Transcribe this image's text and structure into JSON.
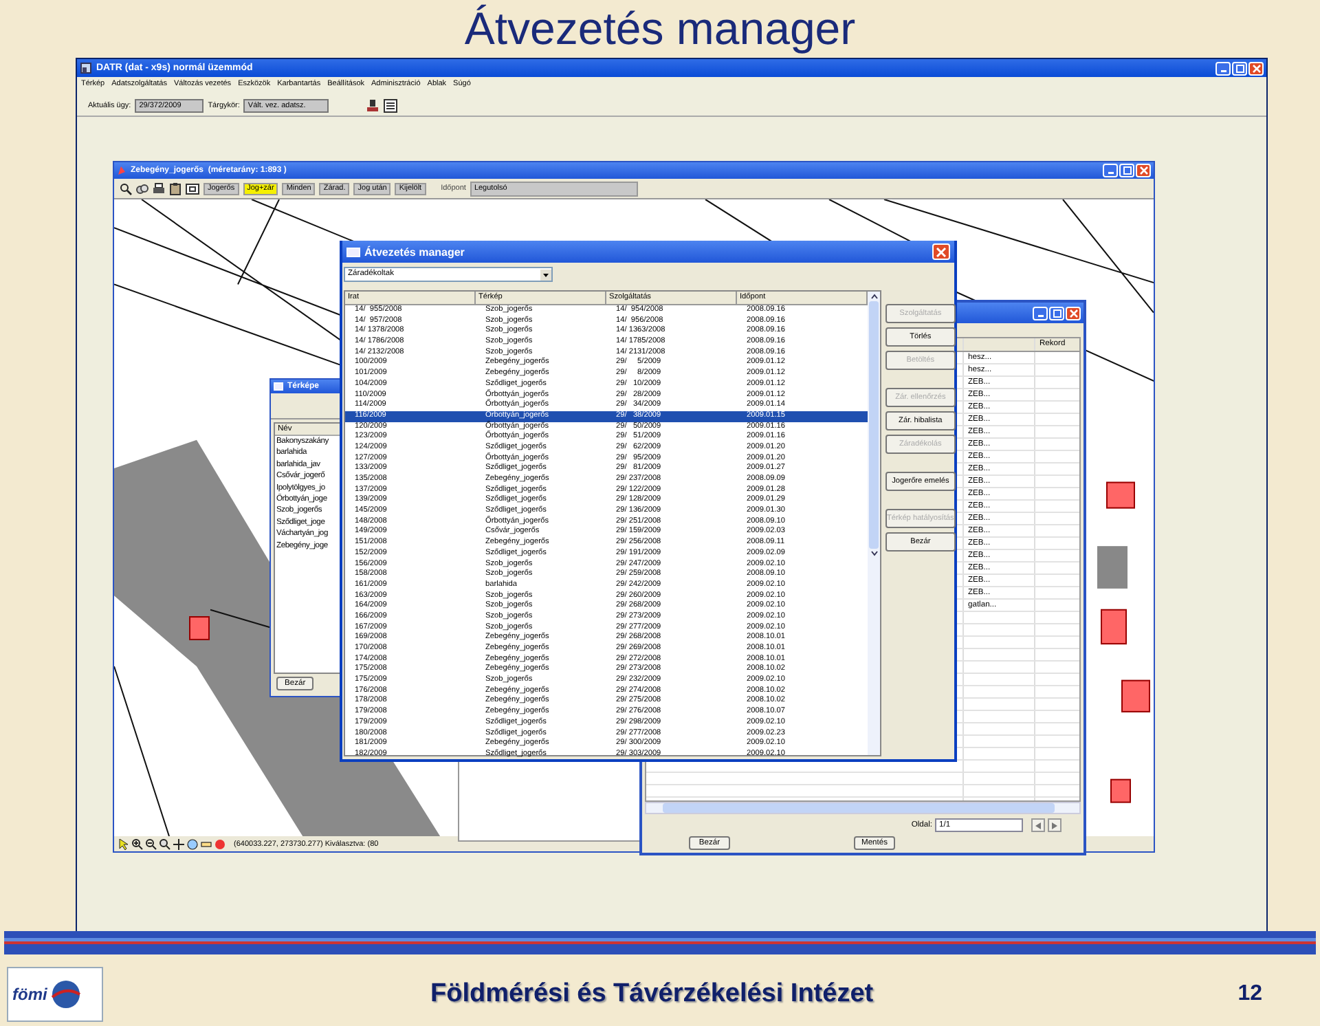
{
  "slide": {
    "title": "Átvezetés manager",
    "logo_text": "fömi",
    "footer": "Földmérési és Távérzékelési Intézet",
    "page_number": "12"
  },
  "app_window": {
    "title": "DATR (dat - x9s) normál üzemmód",
    "menu": [
      "Térkép",
      "Adatszolgáltatás",
      "Változás vezetés",
      "Eszközök",
      "Karbantartás",
      "Beállítások",
      "Adminisztráció",
      "Ablak",
      "Súgó"
    ],
    "case_label": "Aktuális ügy:",
    "case_value": "29/372/2009",
    "topic_label": "Tárgykör:",
    "topic_value": "Vált. vez. adatsz."
  },
  "map_window": {
    "title": "Zebegény_jogerős  (méretarány: 1:893 )",
    "filters": [
      {
        "label": "Jogerős",
        "selected": false
      },
      {
        "label": "Jog+zár",
        "selected": true
      },
      {
        "label": "Minden",
        "selected": false
      },
      {
        "label": "Zárad.",
        "selected": false
      },
      {
        "label": "Jog után",
        "selected": false
      },
      {
        "label": "Kijelölt",
        "selected": false
      }
    ],
    "time_label": "Időpont",
    "time_value": "Legutolsó",
    "status": "(640033.227, 273730.277) Kiválasztva: (80"
  },
  "maps_window": {
    "title": "Térképe",
    "column": "Név",
    "items": [
      "Bakonyszakány",
      "barlahida",
      "barlahida_jav",
      "Csővár_jogerő",
      "Ipolytölgyes_jo",
      "Őrbottyán_joge",
      "Szob_jogerős",
      "Sződliget_joge",
      "Váchartyán_jog",
      "Zebegény_joge"
    ],
    "close_button": "Bezár"
  },
  "records_window": {
    "column": "Rekord",
    "rows": [
      "hesz...",
      "hesz...",
      "ZEB...",
      "ZEB...",
      "ZEB...",
      "ZEB...",
      "ZEB...",
      "ZEB...",
      "ZEB...",
      "ZEB...",
      "ZEB...",
      "ZEB...",
      "ZEB...",
      "ZEB...",
      "ZEB...",
      "ZEB...",
      "ZEB...",
      "ZEB...",
      "ZEB...",
      "ZEB...",
      "gatlan..."
    ],
    "page_label": "Oldal:",
    "page_value": "1/1",
    "buttons": [
      "Bezár",
      "Mentés"
    ]
  },
  "dialog": {
    "title": "Átvezetés manager",
    "filter": "Záradékoltak",
    "columns": [
      "Irat",
      "Térkép",
      "Szolgáltatás",
      "Időpont"
    ],
    "rows": [
      {
        "irat": "14/  955/2008",
        "terkep": "Szob_jogerős",
        "szolg": "14/  954/2008",
        "ido": "2008.09.16",
        "selected": false
      },
      {
        "irat": "14/  957/2008",
        "terkep": "Szob_jogerős",
        "szolg": "14/  956/2008",
        "ido": "2008.09.16",
        "selected": false
      },
      {
        "irat": "14/ 1378/2008",
        "terkep": "Szob_jogerős",
        "szolg": "14/ 1363/2008",
        "ido": "2008.09.16",
        "selected": false
      },
      {
        "irat": "14/ 1786/2008",
        "terkep": "Szob_jogerős",
        "szolg": "14/ 1785/2008",
        "ido": "2008.09.16",
        "selected": false
      },
      {
        "irat": "14/ 2132/2008",
        "terkep": "Szob_jogerős",
        "szolg": "14/ 2131/2008",
        "ido": "2008.09.16",
        "selected": false
      },
      {
        "irat": "100/2009",
        "terkep": "Zebegény_jogerős",
        "szolg": "29/     5/2009",
        "ido": "2009.01.12",
        "selected": false
      },
      {
        "irat": "101/2009",
        "terkep": "Zebegény_jogerős",
        "szolg": "29/     8/2009",
        "ido": "2009.01.12",
        "selected": false
      },
      {
        "irat": "104/2009",
        "terkep": "Sződliget_jogerős",
        "szolg": "29/   10/2009",
        "ido": "2009.01.12",
        "selected": false
      },
      {
        "irat": "110/2009",
        "terkep": "Őrbottyán_jogerős",
        "szolg": "29/   28/2009",
        "ido": "2009.01.12",
        "selected": false
      },
      {
        "irat": "114/2009",
        "terkep": "Őrbottyán_jogerős",
        "szolg": "29/   34/2009",
        "ido": "2009.01.14",
        "selected": false
      },
      {
        "irat": "116/2009",
        "terkep": "Őrbottyán_jogerős",
        "szolg": "29/   38/2009",
        "ido": "2009.01.15",
        "selected": true
      },
      {
        "irat": "120/2009",
        "terkep": "Őrbottyán_jogerős",
        "szolg": "29/   50/2009",
        "ido": "2009.01.16",
        "selected": false
      },
      {
        "irat": "123/2009",
        "terkep": "Őrbottyán_jogerős",
        "szolg": "29/   51/2009",
        "ido": "2009.01.16",
        "selected": false
      },
      {
        "irat": "124/2009",
        "terkep": "Sződliget_jogerős",
        "szolg": "29/   62/2009",
        "ido": "2009.01.20",
        "selected": false
      },
      {
        "irat": "127/2009",
        "terkep": "Őrbottyán_jogerős",
        "szolg": "29/   95/2009",
        "ido": "2009.01.20",
        "selected": false
      },
      {
        "irat": "133/2009",
        "terkep": "Sződliget_jogerős",
        "szolg": "29/   81/2009",
        "ido": "2009.01.27",
        "selected": false
      },
      {
        "irat": "135/2008",
        "terkep": "Zebegény_jogerős",
        "szolg": "29/ 237/2008",
        "ido": "2008.09.09",
        "selected": false
      },
      {
        "irat": "137/2009",
        "terkep": "Sződliget_jogerős",
        "szolg": "29/ 122/2009",
        "ido": "2009.01.28",
        "selected": false
      },
      {
        "irat": "139/2009",
        "terkep": "Sződliget_jogerős",
        "szolg": "29/ 128/2009",
        "ido": "2009.01.29",
        "selected": false
      },
      {
        "irat": "145/2009",
        "terkep": "Sződliget_jogerős",
        "szolg": "29/ 136/2009",
        "ido": "2009.01.30",
        "selected": false
      },
      {
        "irat": "148/2008",
        "terkep": "Őrbottyán_jogerős",
        "szolg": "29/ 251/2008",
        "ido": "2008.09.10",
        "selected": false
      },
      {
        "irat": "149/2009",
        "terkep": "Csővár_jogerős",
        "szolg": "29/ 159/2009",
        "ido": "2009.02.03",
        "selected": false
      },
      {
        "irat": "151/2008",
        "terkep": "Zebegény_jogerős",
        "szolg": "29/ 256/2008",
        "ido": "2008.09.11",
        "selected": false
      },
      {
        "irat": "152/2009",
        "terkep": "Sződliget_jogerős",
        "szolg": "29/ 191/2009",
        "ido": "2009.02.09",
        "selected": false
      },
      {
        "irat": "156/2009",
        "terkep": "Szob_jogerős",
        "szolg": "29/ 247/2009",
        "ido": "2009.02.10",
        "selected": false
      },
      {
        "irat": "158/2008",
        "terkep": "Szob_jogerős",
        "szolg": "29/ 259/2008",
        "ido": "2008.09.10",
        "selected": false
      },
      {
        "irat": "161/2009",
        "terkep": "barlahida",
        "szolg": "29/ 242/2009",
        "ido": "2009.02.10",
        "selected": false
      },
      {
        "irat": "163/2009",
        "terkep": "Szob_jogerős",
        "szolg": "29/ 260/2009",
        "ido": "2009.02.10",
        "selected": false
      },
      {
        "irat": "164/2009",
        "terkep": "Szob_jogerős",
        "szolg": "29/ 268/2009",
        "ido": "2009.02.10",
        "selected": false
      },
      {
        "irat": "166/2009",
        "terkep": "Szob_jogerős",
        "szolg": "29/ 273/2009",
        "ido": "2009.02.10",
        "selected": false
      },
      {
        "irat": "167/2009",
        "terkep": "Szob_jogerős",
        "szolg": "29/ 277/2009",
        "ido": "2009.02.10",
        "selected": false
      },
      {
        "irat": "169/2008",
        "terkep": "Zebegény_jogerős",
        "szolg": "29/ 268/2008",
        "ido": "2008.10.01",
        "selected": false
      },
      {
        "irat": "170/2008",
        "terkep": "Zebegény_jogerős",
        "szolg": "29/ 269/2008",
        "ido": "2008.10.01",
        "selected": false
      },
      {
        "irat": "174/2008",
        "terkep": "Zebegény_jogerős",
        "szolg": "29/ 272/2008",
        "ido": "2008.10.01",
        "selected": false
      },
      {
        "irat": "175/2008",
        "terkep": "Zebegény_jogerős",
        "szolg": "29/ 273/2008",
        "ido": "2008.10.02",
        "selected": false
      },
      {
        "irat": "175/2009",
        "terkep": "Szob_jogerős",
        "szolg": "29/ 232/2009",
        "ido": "2009.02.10",
        "selected": false
      },
      {
        "irat": "176/2008",
        "terkep": "Zebegény_jogerős",
        "szolg": "29/ 274/2008",
        "ido": "2008.10.02",
        "selected": false
      },
      {
        "irat": "178/2008",
        "terkep": "Zebegény_jogerős",
        "szolg": "29/ 275/2008",
        "ido": "2008.10.02",
        "selected": false
      },
      {
        "irat": "179/2008",
        "terkep": "Zebegény_jogerős",
        "szolg": "29/ 276/2008",
        "ido": "2008.10.07",
        "selected": false
      },
      {
        "irat": "179/2009",
        "terkep": "Sződliget_jogerős",
        "szolg": "29/ 298/2009",
        "ido": "2009.02.10",
        "selected": false
      },
      {
        "irat": "180/2008",
        "terkep": "Sződliget_jogerős",
        "szolg": "29/ 277/2008",
        "ido": "2009.02.23",
        "selected": false
      },
      {
        "irat": "181/2009",
        "terkep": "Zebegény_jogerős",
        "szolg": "29/ 300/2009",
        "ido": "2009.02.10",
        "selected": false
      },
      {
        "irat": "182/2009",
        "terkep": "Sződliget_jogerős",
        "szolg": "29/ 303/2009",
        "ido": "2009.02.10",
        "selected": false
      }
    ],
    "button_groups": [
      [
        {
          "label": "Szolgáltatás",
          "disabled": true
        },
        {
          "label": "Törlés",
          "disabled": false
        },
        {
          "label": "Betöltés",
          "disabled": true
        }
      ],
      [
        {
          "label": "Zár. ellenőrzés",
          "disabled": true
        },
        {
          "label": "Zár. hibalista",
          "disabled": false
        },
        {
          "label": "Záradékolás",
          "disabled": true
        }
      ],
      [
        {
          "label": "Jogerőre emelés",
          "disabled": false
        }
      ],
      [
        {
          "label": "Térkép hatályosítás",
          "disabled": true
        },
        {
          "label": "Bezár",
          "disabled": false
        }
      ]
    ]
  }
}
